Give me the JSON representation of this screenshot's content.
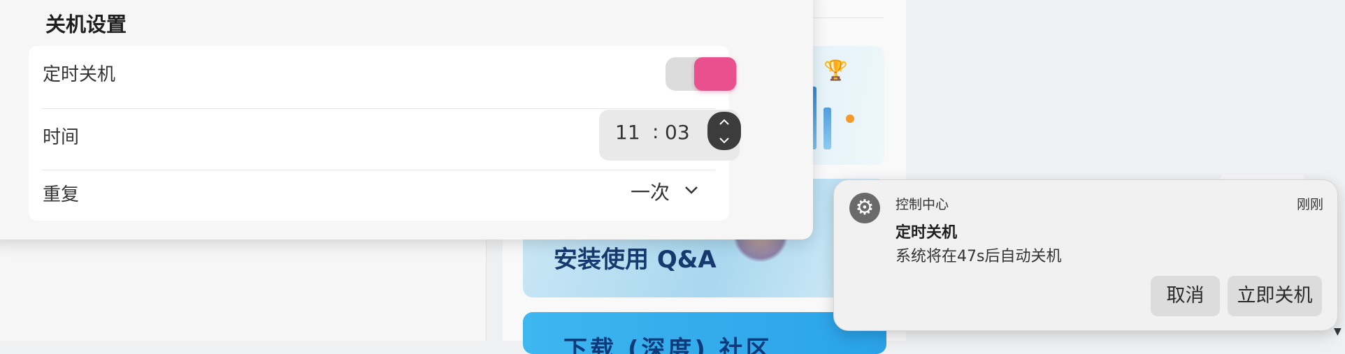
{
  "panel": {
    "title": "关机设置",
    "timed_shutdown": {
      "label": "定时关机",
      "enabled": true,
      "accent_color": "#e8508e"
    },
    "time": {
      "label": "时间",
      "hour": "11",
      "separator": ":",
      "minute": "03"
    },
    "repeat": {
      "label": "重复",
      "value": "一次"
    }
  },
  "background": {
    "qa_card_title": "安装使用 Q&A",
    "blue_card_title": "下载 (深度) 社区"
  },
  "notification": {
    "app_name": "控制中心",
    "time": "刚刚",
    "title": "定时关机",
    "body": "系统将在47s后自动关机",
    "cancel_label": "取消",
    "shutdown_now_label": "立即关机"
  },
  "icons": {
    "gear": "gear-icon",
    "spinner_up": "chevron-up-icon",
    "spinner_down": "chevron-down-icon",
    "repeat_dropdown": "chevron-down-icon"
  }
}
